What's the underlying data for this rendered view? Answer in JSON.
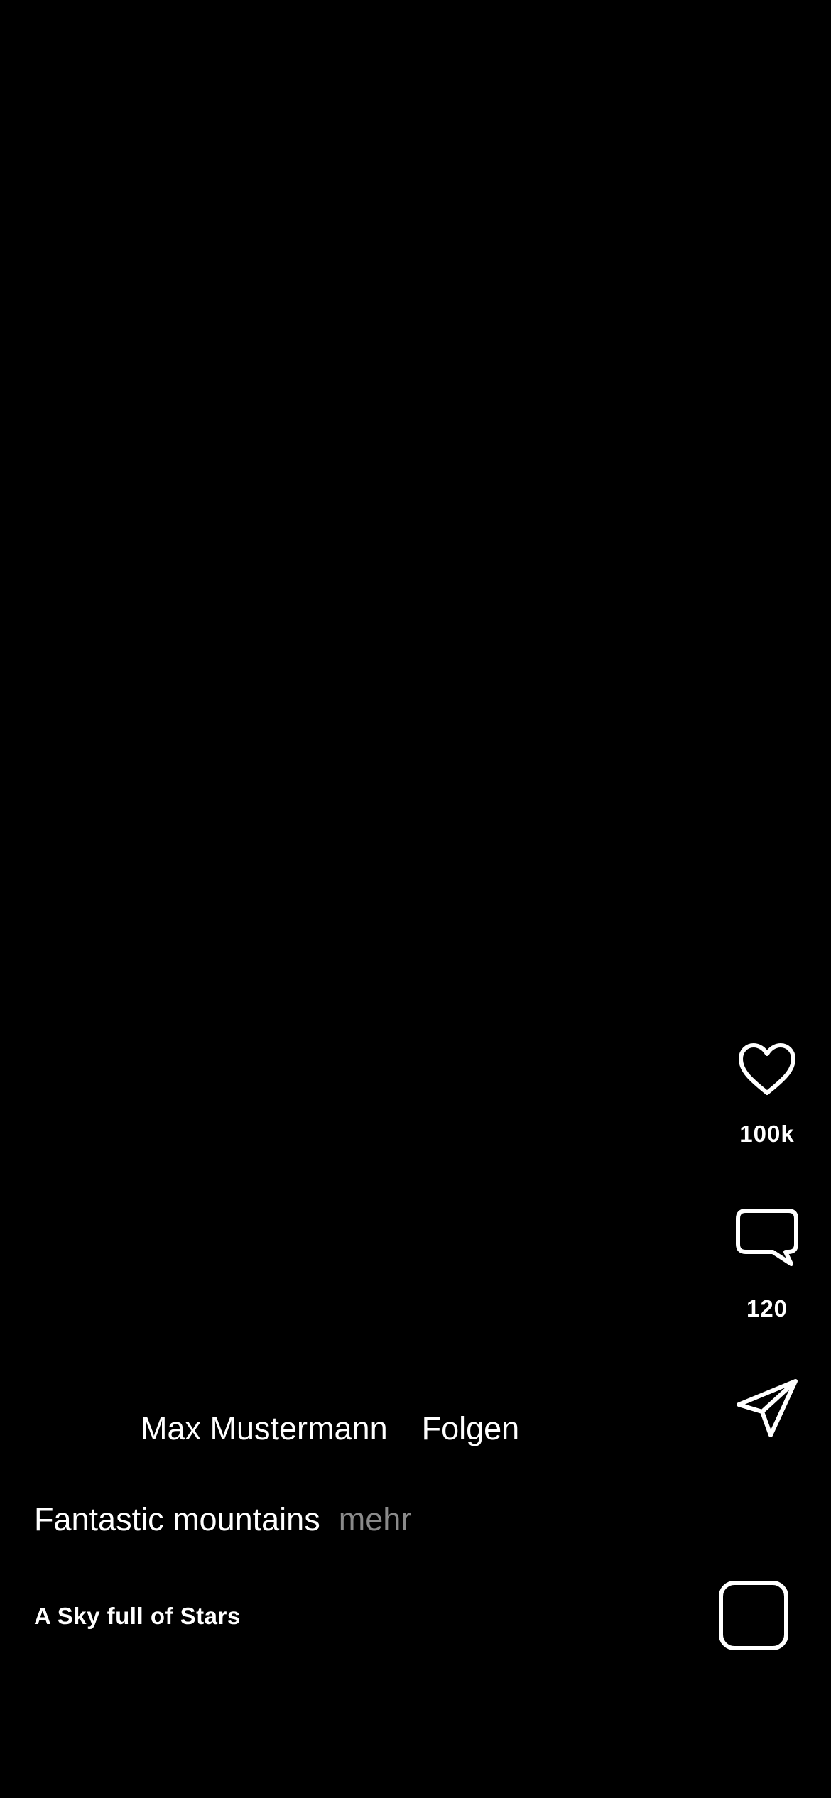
{
  "actions": {
    "like_count": "100k",
    "comment_count": "120"
  },
  "post": {
    "author_name": "Max Mustermann",
    "follow_label": "Folgen",
    "caption": "Fantastic mountains",
    "more_label": "mehr"
  },
  "music": {
    "title": "A Sky full of Stars"
  },
  "icons": {
    "like": "heart-icon",
    "comment": "comment-bubble-icon",
    "share": "paper-plane-icon"
  },
  "colors": {
    "background": "#000000",
    "foreground": "#ffffff",
    "muted": "#8a8a8a"
  }
}
